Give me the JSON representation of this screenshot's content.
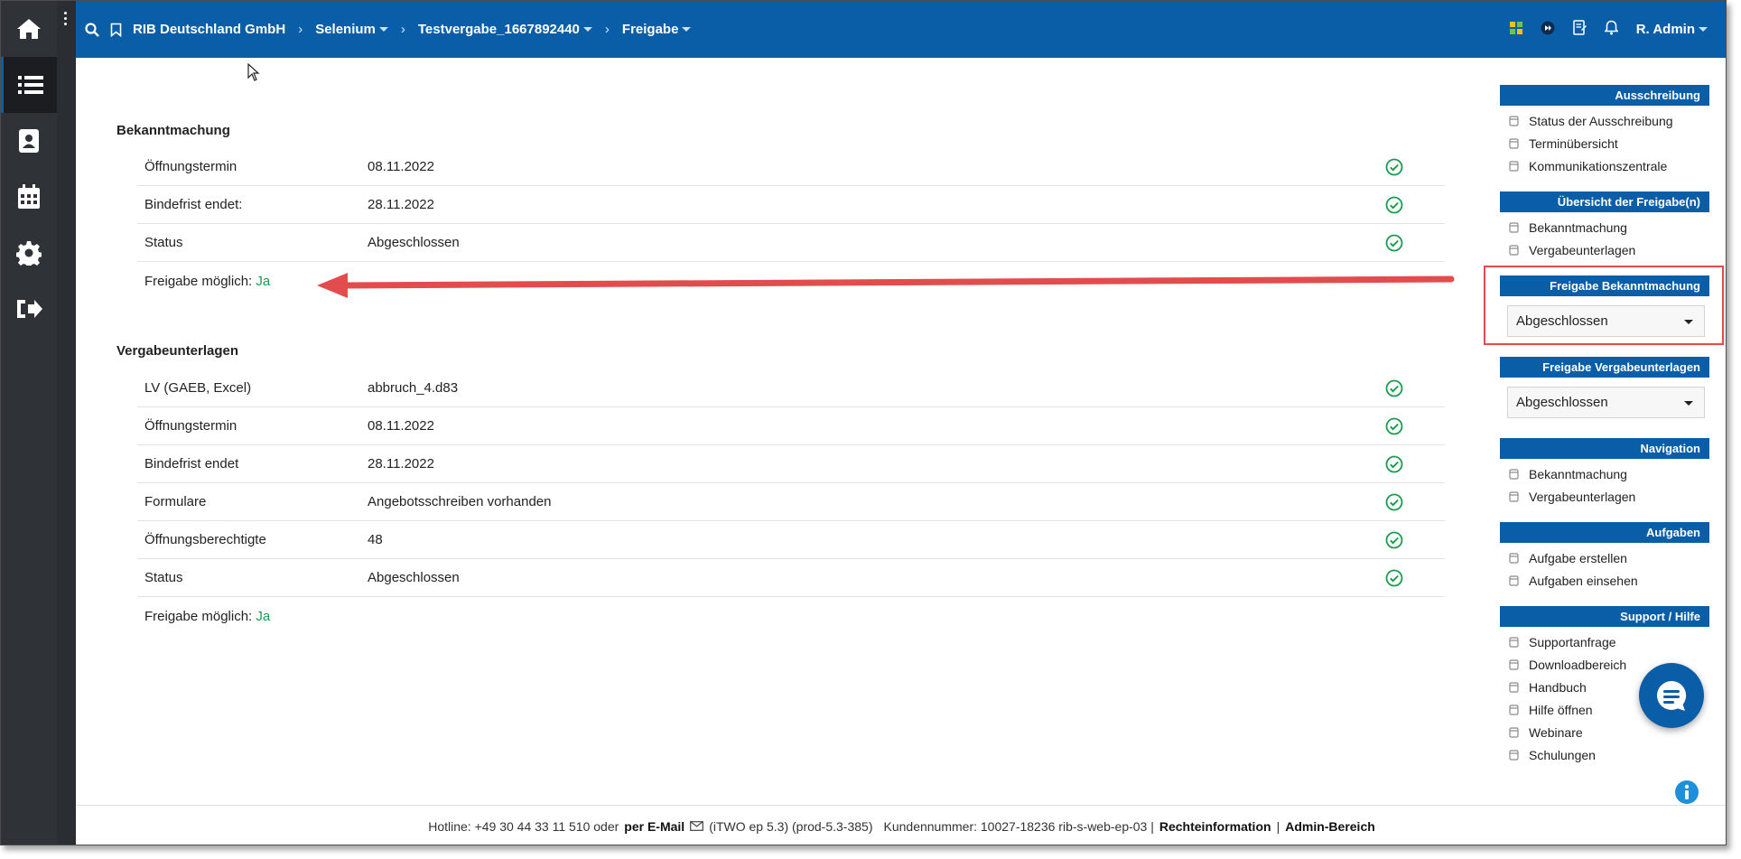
{
  "topbar": {
    "org": "RIB Deutschland GmbH",
    "project": "Selenium",
    "tender": "Testvergabe_1667892440",
    "page": "Freigabe",
    "user": "R. Admin"
  },
  "bekanntmachung": {
    "title": "Bekanntmachung",
    "rows": [
      {
        "label": "Öffnungstermin",
        "value": "08.11.2022"
      },
      {
        "label": "Bindefrist endet:",
        "value": "28.11.2022"
      },
      {
        "label": "Status",
        "value": "Abgeschlossen"
      }
    ],
    "freigabe_label": "Freigabe möglich:",
    "freigabe_value": "Ja"
  },
  "vergabeunterlagen": {
    "title": "Vergabeunterlagen",
    "rows": [
      {
        "label": "LV (GAEB, Excel)",
        "value": "abbruch_4.d83"
      },
      {
        "label": "Öffnungstermin",
        "value": "08.11.2022"
      },
      {
        "label": "Bindefrist endet",
        "value": "28.11.2022"
      },
      {
        "label": "Formulare",
        "value": "Angebotsschreiben vorhanden"
      },
      {
        "label": "Öffnungsberechtigte",
        "value": "48"
      },
      {
        "label": "Status",
        "value": "Abgeschlossen"
      }
    ],
    "freigabe_label": "Freigabe möglich:",
    "freigabe_value": "Ja"
  },
  "right_panel": {
    "ausschreibung": {
      "title": "Ausschreibung",
      "items": [
        "Status der Ausschreibung",
        "Terminübersicht",
        "Kommunikationszentrale"
      ]
    },
    "uebersicht": {
      "title": "Übersicht der Freigabe(n)",
      "items": [
        "Bekanntmachung",
        "Vergabeunterlagen"
      ]
    },
    "freigabe_bek": {
      "title": "Freigabe Bekanntmachung",
      "selected": "Abgeschlossen"
    },
    "freigabe_verg": {
      "title": "Freigabe Vergabeunterlagen",
      "selected": "Abgeschlossen"
    },
    "navigation": {
      "title": "Navigation",
      "items": [
        "Bekanntmachung",
        "Vergabeunterlagen"
      ]
    },
    "aufgaben": {
      "title": "Aufgaben",
      "items": [
        "Aufgabe erstellen",
        "Aufgaben einsehen"
      ]
    },
    "support": {
      "title": "Support / Hilfe",
      "items": [
        "Supportanfrage",
        "Downloadbereich",
        "Handbuch",
        "Hilfe öffnen",
        "Webinare",
        "Schulungen"
      ]
    }
  },
  "footer": {
    "hotline": "Hotline: +49 30 44 33 11 510 oder",
    "email_link": "per E-Mail",
    "version": "(iTWO ep 5.3) (prod-5.3-385)",
    "customer": "Kundennummer: 10027-18236 rib-s-web-ep-03 |",
    "legal": "Rechteinformation",
    "divider": "|",
    "admin": "Admin-Bereich"
  },
  "colors": {
    "brand": "#0a5ea8",
    "success": "#1a9b4e",
    "highlight": "#e24c4c",
    "sidebar": "#2f3237"
  },
  "icons": [
    "home-icon",
    "list-icon",
    "contact-book-icon",
    "calendar-icon",
    "gear-icon",
    "logout-icon",
    "search-icon",
    "bookmark-icon",
    "check-circle-icon",
    "chat-icon",
    "info-icon",
    "bell-icon"
  ]
}
